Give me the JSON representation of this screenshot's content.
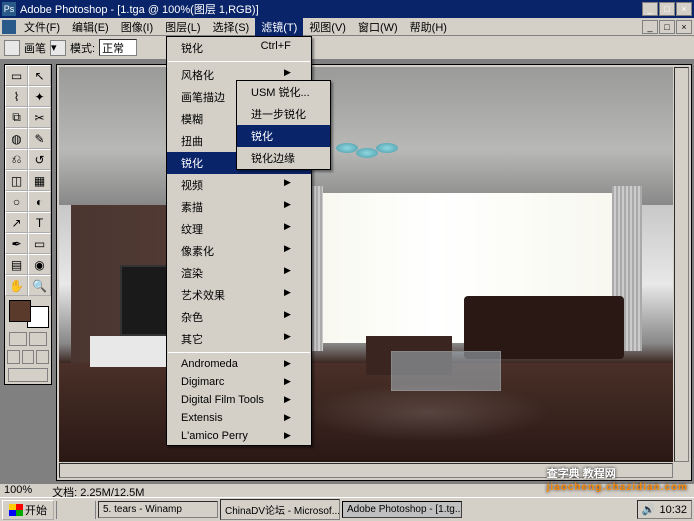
{
  "title": "Adobe Photoshop - [1.tga @ 100%(图层 1,RGB)]",
  "menubar": {
    "items": [
      "文件(F)",
      "编辑(E)",
      "图像(I)",
      "图层(L)",
      "选择(S)",
      "滤镜(T)",
      "视图(V)",
      "窗口(W)",
      "帮助(H)"
    ],
    "active_index": 5
  },
  "optbar": {
    "brush_label": "画笔",
    "mode_label": "模式:",
    "mode_value": "正常"
  },
  "filter_menu": {
    "top": {
      "label": "锐化",
      "shortcut": "Ctrl+F"
    },
    "groups": [
      [
        "风格化",
        "画笔描边",
        "模糊",
        "扭曲"
      ],
      [
        "锐化"
      ],
      [
        "视频",
        "素描",
        "纹理",
        "像素化",
        "渲染",
        "艺术效果",
        "杂色",
        "其它"
      ],
      [
        "Andromeda",
        "Digimarc",
        "Digital Film Tools",
        "Extensis",
        "L'amico Perry"
      ]
    ],
    "active_index": 0
  },
  "submenu": {
    "items": [
      "USM 锐化...",
      "进一步锐化",
      "锐化",
      "锐化边缘"
    ],
    "active_index": 2
  },
  "taskbar": {
    "start": "开始",
    "tasks": [
      "5. tears - Winamp",
      "ChinaDV论坛 - Microsof...",
      "Adobe Photoshop - [1.tg..."
    ],
    "active_task": 2,
    "time": "10:32"
  },
  "statusbar": {
    "zoom": "100%",
    "info": "文档: 2.25M/12.5M"
  },
  "watermark": {
    "main": "查字典 教程网",
    "sub": "jiaocheng.chazidian.com"
  },
  "win_controls": [
    "_",
    "□",
    "×"
  ]
}
